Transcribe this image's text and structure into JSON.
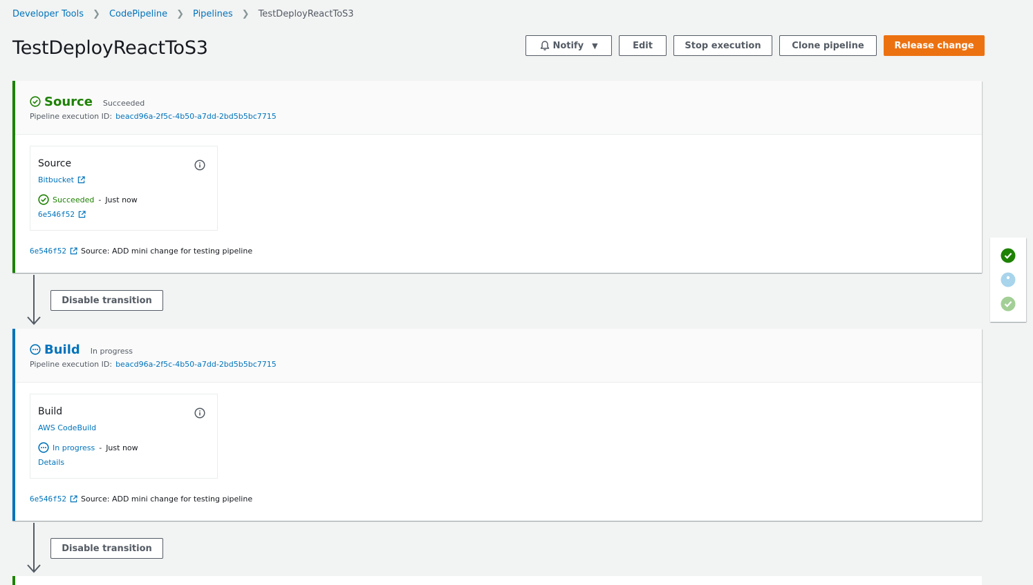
{
  "breadcrumb": {
    "items": [
      "Developer Tools",
      "CodePipeline",
      "Pipelines"
    ],
    "current": "TestDeployReactToS3"
  },
  "page": {
    "title": "TestDeployReactToS3"
  },
  "header_buttons": {
    "notify": "Notify",
    "edit": "Edit",
    "stop": "Stop execution",
    "clone": "Clone pipeline",
    "release": "Release change"
  },
  "stages": [
    {
      "name": "Source",
      "status": "Succeeded",
      "exec_label": "Pipeline execution ID:",
      "exec_id": "beacd96a-2f5c-4b50-a7dd-2bd5b5bc7715",
      "action": {
        "name": "Source",
        "provider": "Bitbucket",
        "status": "Succeeded",
        "time": "Just now",
        "link": "6e546f52"
      },
      "commit": {
        "id": "6e546f52",
        "message": "Source: ADD mini change for testing pipeline"
      }
    },
    {
      "name": "Build",
      "status": "In progress",
      "exec_label": "Pipeline execution ID:",
      "exec_id": "beacd96a-2f5c-4b50-a7dd-2bd5b5bc7715",
      "action": {
        "name": "Build",
        "provider": "AWS CodeBuild",
        "status": "In progress",
        "time": "Just now",
        "link": "Details"
      },
      "commit": {
        "id": "6e546f52",
        "message": "Source: ADD mini change for testing pipeline"
      }
    }
  ],
  "transitions": {
    "disable_label": "Disable transition"
  },
  "status_rail": [
    "succeeded",
    "in-progress",
    "succeeded-faded"
  ],
  "colors": {
    "success": "#1d8102",
    "in_progress": "#0073bb",
    "primary": "#ec7211",
    "link": "#0073bb"
  },
  "icons": {
    "bell": "bell-icon",
    "caret": "caret-down-icon",
    "check": "check-circle-icon",
    "progress": "ellipsis-circle-icon",
    "info": "info-icon",
    "external": "external-link-icon",
    "arrow": "arrow-down-icon"
  }
}
